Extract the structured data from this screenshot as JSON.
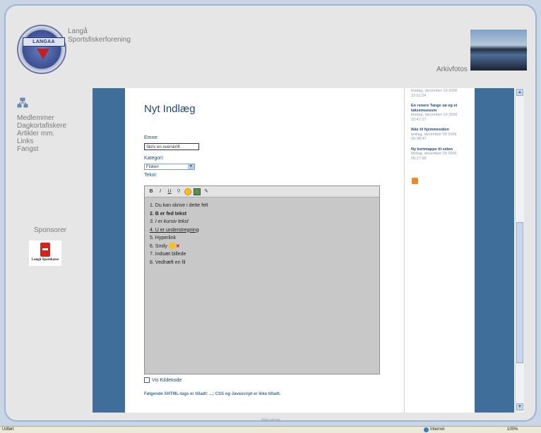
{
  "header": {
    "club_name": [
      "Langå",
      "Sportsfiskerforening"
    ],
    "logo_text": "LANGAA",
    "arkiv_label": "Arkivfotos"
  },
  "menu": [
    "Medlemmer",
    "Dagkortafiskere",
    "Artikler mm.",
    "Links",
    "Fangst"
  ],
  "sponsor": {
    "title": "Sponsorer",
    "name": "Langå Sparekasse"
  },
  "form": {
    "title": "Nyt Indlæg",
    "subject_label": "Emne:",
    "subject_value": "Skriv en overskrift",
    "category_label": "Kategori:",
    "category_value": "Fiskeri",
    "text_label": "Tekst:",
    "toolbar": [
      "B",
      "I",
      "U"
    ],
    "editor_lines": [
      "1. Du kan skrive i dette felt",
      "2. B er fed tekst",
      "3. I er kursiv tekst",
      "4. U er understregning",
      "5. Hyperlink",
      "6. Smily",
      "7. Indsæt billede",
      "8. Vedhæft en fil"
    ],
    "checkbox_label": "Vis Kildekode",
    "note": "Følgende XHTML-tags er tilladt: ...; CSS og Javascript er ikke tilladt."
  },
  "sidebar_posts": [
    {
      "title": "",
      "date": "tirsdag, december 19 2006 22:51:24"
    },
    {
      "title": "En renere Tange sø og et laksemuseum",
      "date": "tirsdag, december 19 2006 22:47:27"
    },
    {
      "title": "Ikke til hjemmesiden",
      "date": "lørdag, december 09 2006 00:38:47"
    },
    {
      "title": "Ny kortmappe til siden",
      "date": "lørdag, december 09 2006 00:27:38"
    }
  ],
  "footer": {
    "text": "Web-udvalg",
    "status_left": "Udført",
    "status_zone": "Internet",
    "status_zoom": "100%"
  }
}
